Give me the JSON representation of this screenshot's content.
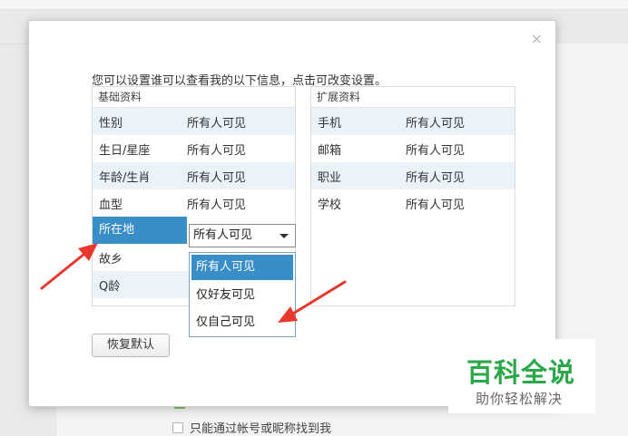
{
  "intro": "您可以设置谁可以查看我的以下信息，点击可改变设置。",
  "close_glyph": "×",
  "basic": {
    "header": "基础资料",
    "rows": [
      {
        "label": "性别",
        "value": "所有人可见"
      },
      {
        "label": "生日/星座",
        "value": "所有人可见"
      },
      {
        "label": "年龄/生肖",
        "value": "所有人可见"
      },
      {
        "label": "血型",
        "value": "所有人可见"
      },
      {
        "label": "所在地",
        "value": "所有人可见"
      },
      {
        "label": "故乡",
        "value": ""
      },
      {
        "label": "Q龄",
        "value": ""
      }
    ]
  },
  "extended": {
    "header": "扩展资料",
    "rows": [
      {
        "label": "手机",
        "value": "所有人可见"
      },
      {
        "label": "邮箱",
        "value": "所有人可见"
      },
      {
        "label": "职业",
        "value": "所有人可见"
      },
      {
        "label": "学校",
        "value": "所有人可见"
      }
    ]
  },
  "select": {
    "selected": "所有人可见",
    "options": [
      "所有人可见",
      "仅好友可见",
      "仅自己可见"
    ]
  },
  "reset_label": "恢复默认",
  "background": {
    "checkbox_label": "只能通过帐号或昵称找到我"
  },
  "watermark": {
    "title": "百科全说",
    "subtitle": "助你轻松解决"
  },
  "colors": {
    "accent": "#3a8ec8",
    "row_alt": "#ebf3fa",
    "arrow": "#e8382e",
    "watermark": "#2aa84a"
  }
}
